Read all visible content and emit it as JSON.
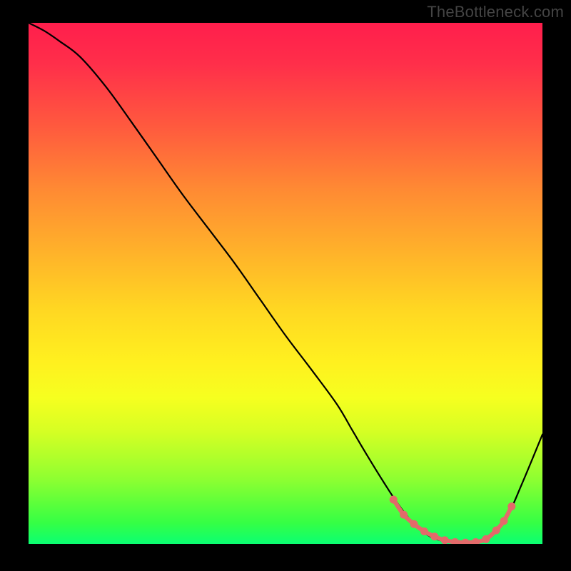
{
  "watermark": "TheBottleneck.com",
  "chart_data": {
    "type": "line",
    "title": "",
    "xlabel": "",
    "ylabel": "",
    "xlim": [
      0,
      100
    ],
    "ylim": [
      0,
      100
    ],
    "grid": false,
    "series": [
      {
        "name": "bottleneck-curve",
        "x": [
          0,
          3,
          6,
          10,
          15,
          20,
          25,
          30,
          35,
          40,
          45,
          50,
          55,
          60,
          63,
          66,
          69,
          72,
          75,
          78,
          81,
          84,
          86,
          88,
          90,
          93,
          96,
          100
        ],
        "y": [
          100,
          98.5,
          96.5,
          93.5,
          87.8,
          81,
          74,
          67,
          60.5,
          54,
          47,
          40,
          33.5,
          26.8,
          21.8,
          16.8,
          12,
          7.5,
          3.8,
          1.5,
          0.5,
          0.2,
          0.2,
          0.5,
          1.5,
          5,
          11.5,
          21
        ]
      }
    ],
    "markers": {
      "name": "highlight-dots",
      "color": "#e36a6a",
      "x": [
        71,
        73,
        75,
        77,
        79,
        81,
        83,
        85,
        87,
        89,
        91,
        92.5,
        94
      ],
      "y": [
        8.5,
        5.6,
        3.8,
        2.4,
        1.4,
        0.7,
        0.35,
        0.25,
        0.35,
        0.9,
        2.6,
        4.4,
        7.2
      ]
    }
  }
}
